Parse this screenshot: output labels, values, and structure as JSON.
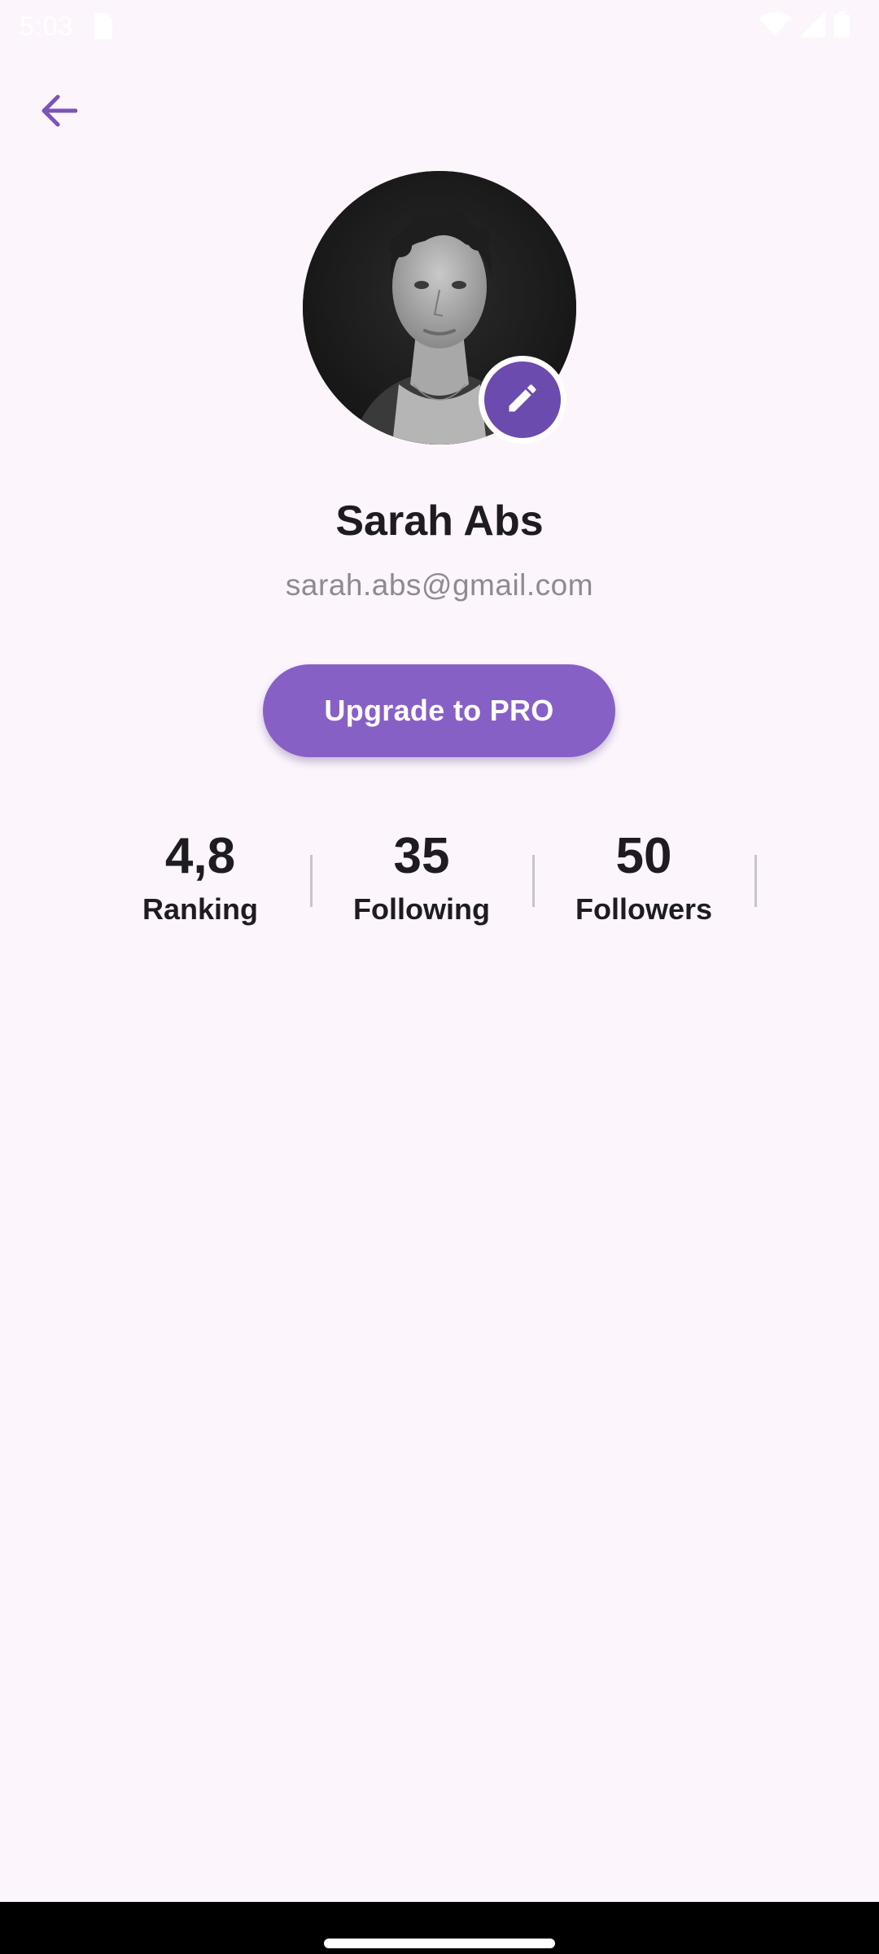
{
  "status_bar": {
    "time": "5:03",
    "icons": [
      "sim-card-icon",
      "wifi-icon",
      "signal-icon",
      "battery-icon"
    ]
  },
  "header": {
    "back_icon": "arrow-back-icon"
  },
  "profile": {
    "name": "Sarah Abs",
    "email": "sarah.abs@gmail.com",
    "avatar": "profile-photo",
    "edit_icon": "pencil-icon"
  },
  "upgrade_button": {
    "label": "Upgrade to PRO"
  },
  "stats": [
    {
      "value": "4,8",
      "label": "Ranking"
    },
    {
      "value": "35",
      "label": "Following"
    },
    {
      "value": "50",
      "label": "Followers"
    }
  ],
  "colors": {
    "background": "#FCF5FC",
    "accent": "#8760C6",
    "accent_dark": "#6C4BAF",
    "text_primary": "#1F1B22",
    "text_secondary": "#8E8A92",
    "divider": "#C9C3CC"
  }
}
